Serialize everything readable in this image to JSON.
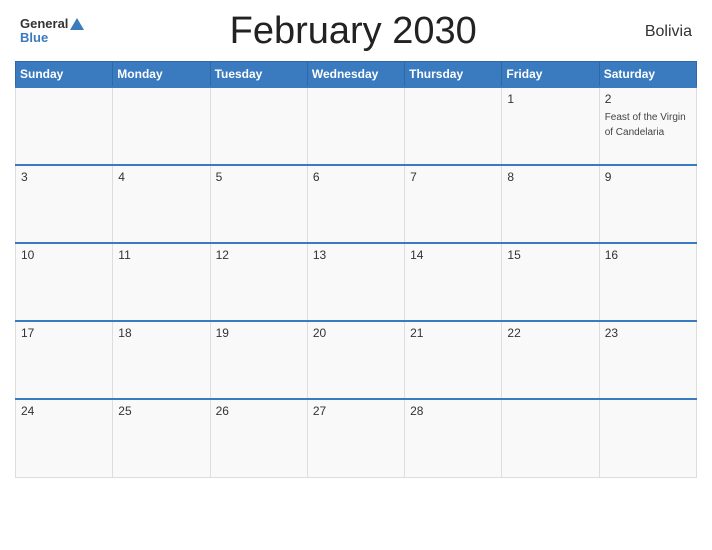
{
  "header": {
    "logo_general": "General",
    "logo_blue": "Blue",
    "title": "February 2030",
    "country": "Bolivia"
  },
  "calendar": {
    "days_of_week": [
      "Sunday",
      "Monday",
      "Tuesday",
      "Wednesday",
      "Thursday",
      "Friday",
      "Saturday"
    ],
    "weeks": [
      [
        {
          "day": "",
          "event": ""
        },
        {
          "day": "",
          "event": ""
        },
        {
          "day": "",
          "event": ""
        },
        {
          "day": "",
          "event": ""
        },
        {
          "day": "",
          "event": ""
        },
        {
          "day": "1",
          "event": ""
        },
        {
          "day": "2",
          "event": "Feast of the Virgin of Candelaria"
        }
      ],
      [
        {
          "day": "3",
          "event": ""
        },
        {
          "day": "4",
          "event": ""
        },
        {
          "day": "5",
          "event": ""
        },
        {
          "day": "6",
          "event": ""
        },
        {
          "day": "7",
          "event": ""
        },
        {
          "day": "8",
          "event": ""
        },
        {
          "day": "9",
          "event": ""
        }
      ],
      [
        {
          "day": "10",
          "event": ""
        },
        {
          "day": "11",
          "event": ""
        },
        {
          "day": "12",
          "event": ""
        },
        {
          "day": "13",
          "event": ""
        },
        {
          "day": "14",
          "event": ""
        },
        {
          "day": "15",
          "event": ""
        },
        {
          "day": "16",
          "event": ""
        }
      ],
      [
        {
          "day": "17",
          "event": ""
        },
        {
          "day": "18",
          "event": ""
        },
        {
          "day": "19",
          "event": ""
        },
        {
          "day": "20",
          "event": ""
        },
        {
          "day": "21",
          "event": ""
        },
        {
          "day": "22",
          "event": ""
        },
        {
          "day": "23",
          "event": ""
        }
      ],
      [
        {
          "day": "24",
          "event": ""
        },
        {
          "day": "25",
          "event": ""
        },
        {
          "day": "26",
          "event": ""
        },
        {
          "day": "27",
          "event": ""
        },
        {
          "day": "28",
          "event": ""
        },
        {
          "day": "",
          "event": ""
        },
        {
          "day": "",
          "event": ""
        }
      ]
    ]
  }
}
